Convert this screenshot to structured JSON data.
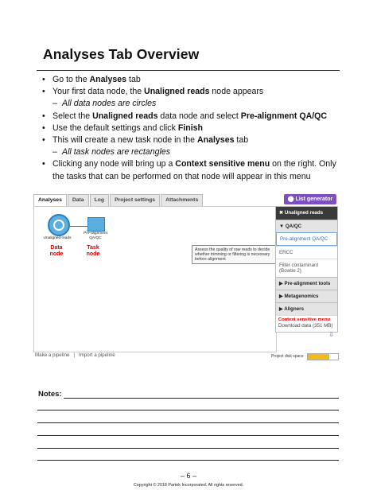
{
  "title": "Analyses Tab Overview",
  "bullets": [
    {
      "kind": "b",
      "parts": [
        [
          "Go to the ",
          false
        ],
        [
          "Analyses",
          true
        ],
        [
          " tab",
          false
        ]
      ]
    },
    {
      "kind": "b",
      "parts": [
        [
          "Your first data node, the ",
          false
        ],
        [
          "Unaligned reads",
          true
        ],
        [
          " node appears",
          false
        ]
      ]
    },
    {
      "kind": "s",
      "text": "All data nodes are circles"
    },
    {
      "kind": "b",
      "parts": [
        [
          "Select the ",
          false
        ],
        [
          "Unaligned reads",
          true
        ],
        [
          " data node and select ",
          false
        ],
        [
          "Pre-alignment QA/QC",
          true
        ]
      ]
    },
    {
      "kind": "b",
      "parts": [
        [
          "Use the default settings and click ",
          false
        ],
        [
          "Finish",
          true
        ]
      ]
    },
    {
      "kind": "b",
      "parts": [
        [
          "This will create a new task node in the ",
          false
        ],
        [
          "Analyses",
          true
        ],
        [
          " tab",
          false
        ]
      ]
    },
    {
      "kind": "s",
      "text": "All task nodes are rectangles"
    },
    {
      "kind": "b",
      "parts": [
        [
          "Clicking any node will bring up a ",
          false
        ],
        [
          "Context sensitive menu",
          true
        ],
        [
          " on the right. Only the tasks that can be performed on that node will appear in this menu",
          false
        ]
      ]
    }
  ],
  "bullet_marker": "•",
  "sub_marker": "–",
  "screenshot": {
    "tabs": [
      "Analyses",
      "Data",
      "Log",
      "Project settings",
      "Attachments"
    ],
    "list_generator": "List generator",
    "data_node_label": "Unaligned reads",
    "task_node_label": "Pre-alignment QA/QC",
    "data_node_callout": "Data node",
    "task_node_callout": "Task node",
    "tooltip": "Assess the quality of raw reads to decide whether trimming or filtering is necessary before alignment",
    "make_pipeline": "Make a pipeline",
    "separator": "|",
    "import_pipeline": "Import a pipeline",
    "menu": {
      "header": "Unaligned reads",
      "qa_group": "QA/QC",
      "qa_items": [
        "Pre-alignment QA/QC",
        "ERCC",
        "Filter contaminant (Bowtie 2)"
      ],
      "groups": [
        "Pre-alignment tools",
        "Metagenomics",
        "Aligners"
      ],
      "ctx_label": "Context sensitive menu",
      "download": "Download data (351 MB)"
    },
    "disk_label": "Project disk space",
    "disk_fill": 0.7,
    "colors": {
      "accent": "#7d4fc3",
      "callout": "#d00000",
      "node": "#5aaee0",
      "disk": "#f2b91a"
    }
  },
  "notes_label": "Notes:",
  "page_number": "– 6 –",
  "copyright": "Copyright © 2018 Partek Incorporated. All rights reserved."
}
